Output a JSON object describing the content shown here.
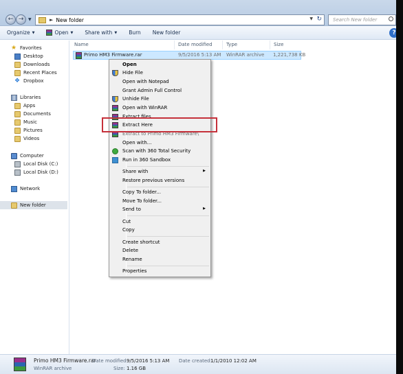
{
  "address": {
    "path": "New folder"
  },
  "search": {
    "placeholder": "Search New folder"
  },
  "toolbar": {
    "organize": "Organize",
    "open": "Open",
    "share_with": "Share with",
    "burn": "Burn",
    "new_folder": "New folder"
  },
  "nav": {
    "favorites": "Favorites",
    "desktop": "Desktop",
    "downloads": "Downloads",
    "recent_places": "Recent Places",
    "dropbox": "Dropbox",
    "libraries": "Libraries",
    "apps": "Apps",
    "documents": "Documents",
    "music": "Music",
    "pictures": "Pictures",
    "videos": "Videos",
    "computer": "Computer",
    "local_c": "Local Disk (C:)",
    "local_d": "Local Disk (D:)",
    "network": "Network",
    "new_folder": "New folder"
  },
  "columns": {
    "name": "Name",
    "date": "Date modified",
    "type": "Type",
    "size": "Size"
  },
  "file": {
    "name": "Primo HM3 Firmware.rar",
    "date": "9/5/2016 5:13 AM",
    "type": "WinRAR archive",
    "size": "1,221,738 KB"
  },
  "context_menu": {
    "open": "Open",
    "hide_file": "Hide File",
    "open_notepad": "Open with Notepad",
    "grant_admin": "Grant Admin Full Control",
    "unhide_file": "Unhide File",
    "open_winrar": "Open with WinRAR",
    "extract_files": "Extract files...",
    "extract_here": "Extract Here",
    "extract_to": "Extract to Primo HM3 Firmware\\",
    "open_with": "Open with...",
    "scan_360": "Scan with 360 Total Security",
    "run_sandbox": "Run in 360 Sandbox",
    "share_with": "Share with",
    "restore_versions": "Restore previous versions",
    "copy_to": "Copy To folder...",
    "move_to": "Move To folder...",
    "send_to": "Send to",
    "cut": "Cut",
    "copy": "Copy",
    "create_shortcut": "Create shortcut",
    "delete": "Delete",
    "rename": "Rename",
    "properties": "Properties"
  },
  "details": {
    "name": "Primo HM3 Firmware.rar",
    "type": "WinRAR archive",
    "date_modified_label": "Date modified:",
    "date_modified": "9/5/2016 5:13 AM",
    "size_label": "Size:",
    "size": "1.16 GB",
    "date_created_label": "Date created:",
    "date_created": "1/1/2010 12:02 AM"
  },
  "colors": {
    "highlight_box": "#c5303a",
    "selection": "#cce8ff"
  }
}
